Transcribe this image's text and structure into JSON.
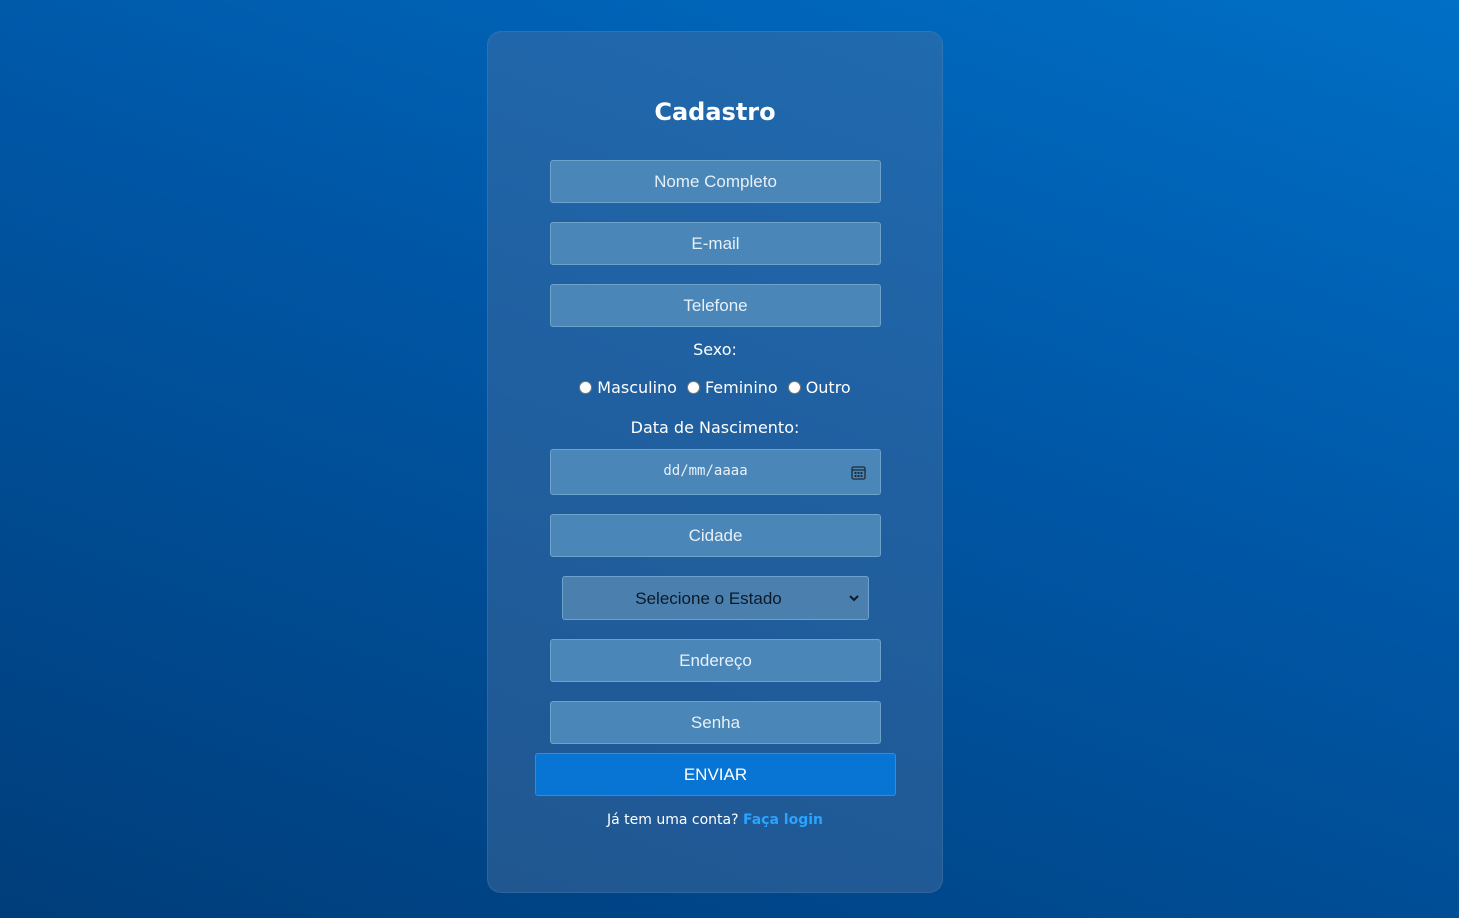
{
  "form": {
    "title": "Cadastro",
    "fields": {
      "nome": {
        "placeholder": "Nome Completo",
        "value": ""
      },
      "email": {
        "placeholder": "E-mail",
        "value": ""
      },
      "telefone": {
        "placeholder": "Telefone",
        "value": ""
      },
      "cidade": {
        "placeholder": "Cidade",
        "value": ""
      },
      "endereco": {
        "placeholder": "Endereço",
        "value": ""
      },
      "senha": {
        "placeholder": "Senha",
        "value": ""
      }
    },
    "sexo": {
      "label": "Sexo:",
      "options": [
        "Masculino",
        "Feminino",
        "Outro"
      ]
    },
    "nascimento": {
      "label": "Data de Nascimento:",
      "placeholder": "dd/mm/aaaa",
      "icon": "calendar-icon"
    },
    "estado": {
      "selected": "Selecione o Estado",
      "icon": "chevron-down-icon"
    },
    "submit_label": "ENVIAR",
    "footer": {
      "text": "Já tem uma conta?",
      "link": "Faça login"
    }
  },
  "colors": {
    "background": "#0058a8",
    "field": "#4a86b8",
    "button": "#0874d4",
    "link": "#2aa4ff"
  }
}
